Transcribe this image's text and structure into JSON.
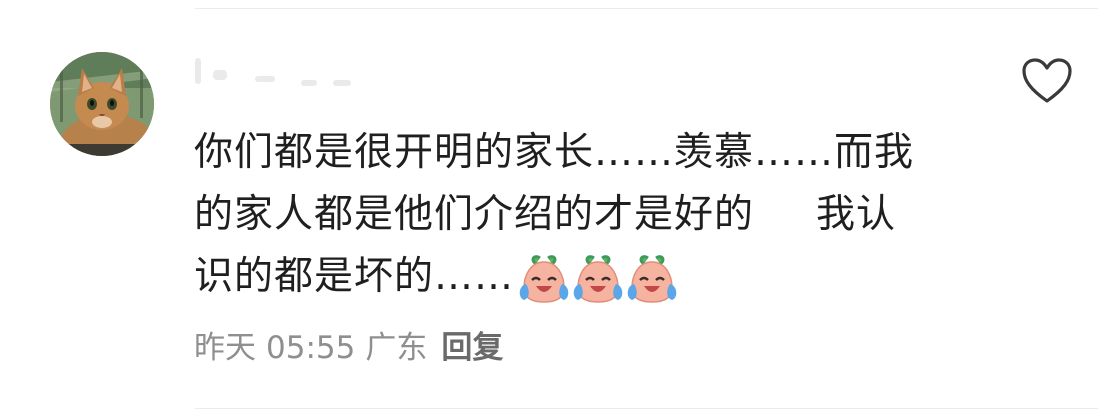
{
  "comment": {
    "lines": [
      "你们都是很开明的家长……羡慕……而我",
      "的家人都是他们介绍的才是好的",
      "我认",
      "识的都是坏的……"
    ],
    "emojis": [
      "crying-laughing-emoji",
      "crying-laughing-emoji",
      "crying-laughing-emoji"
    ]
  },
  "meta": {
    "date": "昨天",
    "time": "05:55",
    "location": "广东",
    "reply_label": "回复"
  },
  "icons": {
    "like": "heart-icon",
    "avatar": "cat-avatar"
  },
  "colors": {
    "text": "#1f1f1f",
    "meta": "#8f8f8f",
    "reply": "#6a6a6a",
    "icon": "#3a3a3a"
  }
}
